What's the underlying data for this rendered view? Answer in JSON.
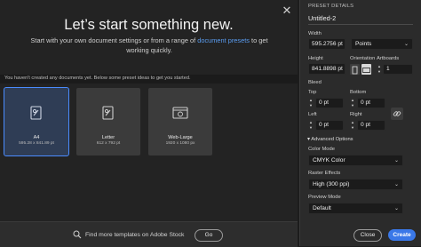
{
  "hero": {
    "title": "Let’s start something new.",
    "subtitle_before": "Start with your own document settings or from a range of ",
    "subtitle_link": "document presets",
    "subtitle_after": " to get working quickly."
  },
  "notice": "You haven't created any documents yet. Below some preset ideas to get you started.",
  "presets": [
    {
      "name": "A4",
      "dims": "595.28 x 841.89 pt",
      "selected": true
    },
    {
      "name": "Letter",
      "dims": "612 x 792 pt",
      "selected": false
    },
    {
      "name": "Web-Large",
      "dims": "1920 x 1080 px",
      "selected": false
    }
  ],
  "footer": {
    "stock_text": "Find more templates on Adobe Stock",
    "go_label": "Go"
  },
  "details": {
    "section_title": "PRESET DETAILS",
    "doc_name": "Untitled-2",
    "width_label": "Width",
    "width_value": "595.2756 pt",
    "units_value": "Points",
    "height_label": "Height",
    "height_value": "841.8898 pt",
    "orientation_label": "Orientation",
    "artboards_label": "Artboards",
    "artboards_value": "1",
    "bleed_label": "Bleed",
    "top_label": "Top",
    "top_value": "0 pt",
    "bottom_label": "Bottom",
    "bottom_value": "0 pt",
    "left_label": "Left",
    "left_value": "0 pt",
    "right_label": "Right",
    "right_value": "0 pt",
    "advanced_label": "Advanced Options",
    "color_mode_label": "Color Mode",
    "color_mode_value": "CMYK Color",
    "raster_label": "Raster Effects",
    "raster_value": "High (300 ppi)",
    "preview_label": "Preview Mode",
    "preview_value": "Default",
    "close_label": "Close",
    "create_label": "Create"
  },
  "colors": {
    "accent": "#3a78e8",
    "link": "#5a9cf0",
    "selected_border": "#4a8cff"
  }
}
